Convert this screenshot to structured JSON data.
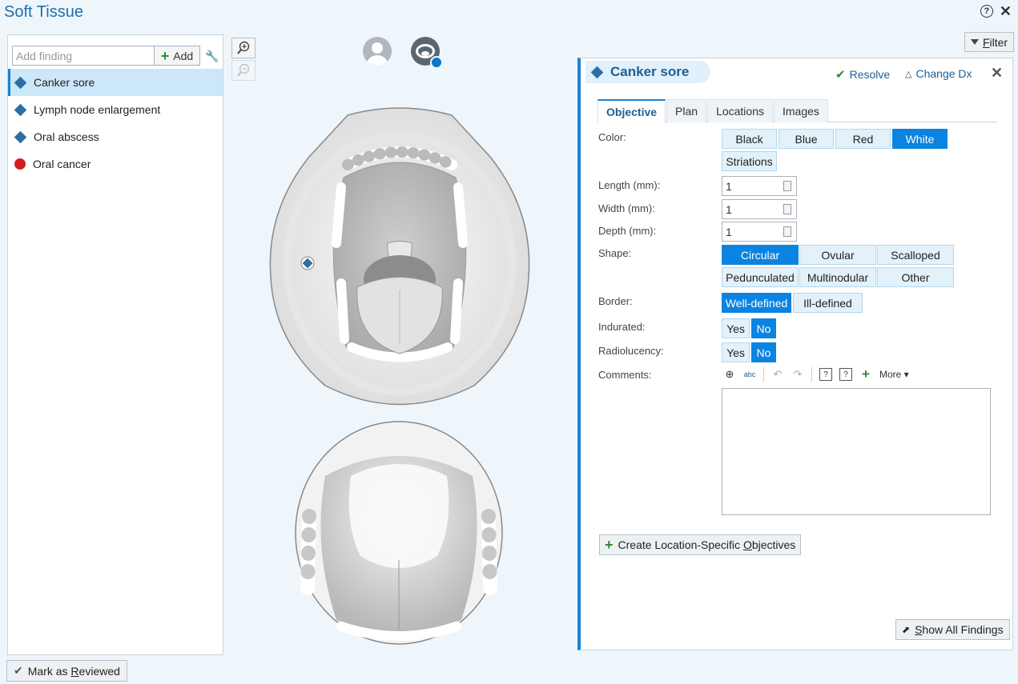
{
  "window": {
    "title": "Soft Tissue"
  },
  "left": {
    "add_placeholder": "Add finding",
    "add_label": "Add",
    "findings": [
      {
        "label": "Canker sore",
        "icon": "diamond-icon",
        "color": "#2a6fa5",
        "selected": true
      },
      {
        "label": "Lymph node enlargement",
        "icon": "diamond-icon",
        "color": "#2a6fa5"
      },
      {
        "label": "Oral abscess",
        "icon": "diamond-icon",
        "color": "#2a6fa5"
      },
      {
        "label": "Oral cancer",
        "icon": "cancer-icon",
        "color": "#d21e1e"
      }
    ],
    "reviewed_pre": "Mark as ",
    "reviewed_u": "R",
    "reviewed_post": "eviewed"
  },
  "toolbar": {
    "filter_u": "F",
    "filter_post": "ilter"
  },
  "detail": {
    "title": "Canker sore",
    "resolve": "Resolve",
    "change_dx": "Change Dx",
    "tabs": [
      "Objective",
      "Plan",
      "Locations",
      "Images"
    ],
    "color_label": "Color:",
    "colors": [
      "Black",
      "Blue",
      "Red",
      "White",
      "Striations"
    ],
    "length_label": "Length (mm):",
    "length": "1",
    "width_label": "Width (mm):",
    "width": "1",
    "depth_label": "Depth (mm):",
    "depth": "1",
    "shape_label": "Shape:",
    "shapes": [
      "Circular",
      "Ovular",
      "Scalloped",
      "Pedunculated",
      "Multinodular",
      "Other"
    ],
    "border_label": "Border:",
    "borders": [
      "Well-defined",
      "Ill-defined"
    ],
    "indurated_label": "Indurated:",
    "radiolucency_label": "Radiolucency:",
    "yes": "Yes",
    "no": "No",
    "comments_label": "Comments:",
    "more": "More",
    "create_pre": "Create Location-Specific ",
    "create_u": "O",
    "create_post": "bjectives",
    "showall_u": "S",
    "showall_post": "how All Findings"
  },
  "accent": "#0a84e0"
}
